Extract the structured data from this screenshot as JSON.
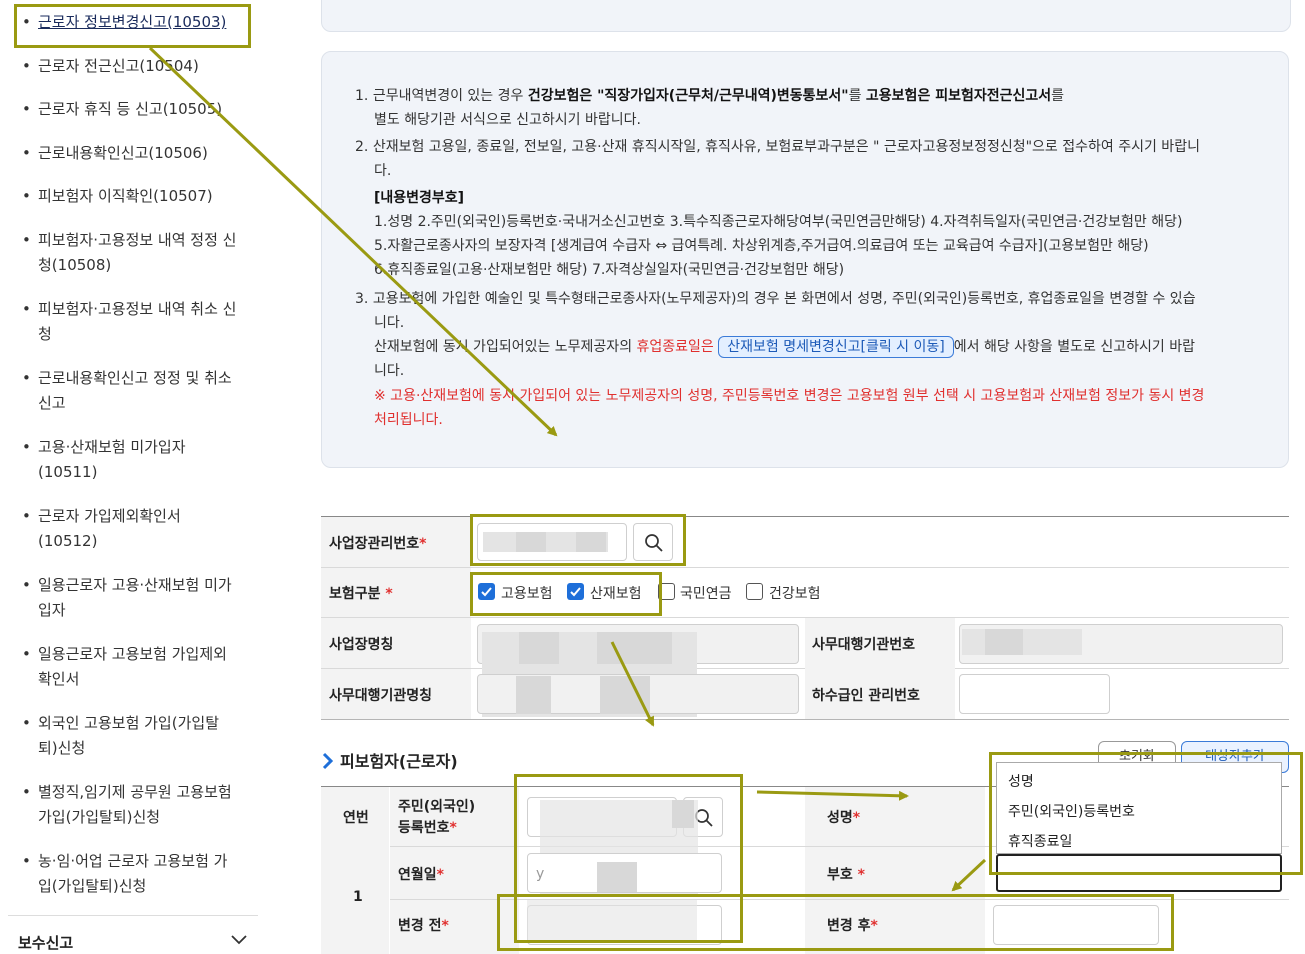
{
  "sidebar": {
    "items": [
      {
        "label": "근로자 정보변경신고(10503)"
      },
      {
        "label": "근로자 전근신고(10504)"
      },
      {
        "label": "근로자 휴직 등 신고(10505)"
      },
      {
        "label": "근로내용확인신고(10506)"
      },
      {
        "label": "피보험자 이직확인(10507)"
      },
      {
        "label": "피보험자·고용정보 내역 정정 신청(10508)"
      },
      {
        "label": "피보험자·고용정보 내역 취소 신청"
      },
      {
        "label": "근로내용확인신고 정정 및 취소 신고"
      },
      {
        "label": "고용·산재보험 미가입자 (10511)"
      },
      {
        "label": "근로자 가입제외확인서 (10512)"
      },
      {
        "label": "일용근로자 고용·산재보험 미가입자"
      },
      {
        "label": "일용근로자 고용보험 가입제외 확인서"
      },
      {
        "label": "외국인 고용보험 가입(가입탈퇴)신청"
      },
      {
        "label": "별정직,임기제 공무원 고용보험 가입(가입탈퇴)신청"
      },
      {
        "label": "농·임·어업 근로자 고용보험 가입(가입탈퇴)신청"
      }
    ],
    "section_label": "보수신고",
    "bullet": "•"
  },
  "notice": {
    "l1_num": "1.",
    "l1_a": "근무내역변경이 있는 경우 ",
    "l1_b": "건강보험은 \"직장가입자(근무처/근무내역)변동통보서\"",
    "l1_c": "를 ",
    "l1_d": "고용보험은 피보험자전근신고서",
    "l1_e": "를",
    "l1_2": "별도 해당기관 서식으로 신고하시기 바랍니다.",
    "l2_num": "2.",
    "l2_1": "산재보험 고용일, 종료일, 전보일, 고용·산재 휴직시작일, 휴직사유, 보험료부과구분은 \" 근로자고용정보정정신청\"으로 접수하여 주시기 바랍니",
    "l2_2": "다.",
    "code_title": "[내용변경부호]",
    "code_1": "1.성명 2.주민(외국인)등록번호·국내거소신고번호 3.특수직종근로자해당여부(국민연금만해당) 4.자격취득일자(국민연금·건강보험만 해당)",
    "code_2": "5.자활근로종사자의 보장자격 [생계급여 수급자 ⇔ 급여특례. 차상위계층,주거급여.의료급여 또는 교육급여 수급자](고용보험만 해당)",
    "code_3": "6.휴직종료일(고용·산재보험만 해당) 7.자격상실일자(국민연금·건강보험만 해당)",
    "l3_num": "3.",
    "l3_1": "고용보험에 가입한 예술인 및 특수형태근로종사자(노무제공자)의 경우 본 화면에서 성명, 주민(외국인)등록번호, 휴업종료일을 변경할 수 있습",
    "l3_2": "니다.",
    "l3_3a": "산재보험에 동시 가입되어있는 노무제공자의 ",
    "l3_3b": "휴업종료일은",
    "l3_link": "산재보험 명세변경신고[클릭 시 이동]",
    "l3_3c": "에서 해당 사항을 별도로 신고하시기 바랍",
    "l3_4": "니다.",
    "warn_1": "※ 고용·산재보험에 동시 가입되어 있는 노무제공자의 성명, 주민등록번호 변경은 고용보험 원부 선택 시 고용보험과 산재보험 정보가 동시 변경",
    "warn_2": "처리됩니다."
  },
  "form": {
    "biz_no_label": "사업장관리번호",
    "ins_type_label": "보험구분",
    "checkboxes": [
      {
        "label": "고용보험",
        "checked": true
      },
      {
        "label": "산재보험",
        "checked": true
      },
      {
        "label": "국민연금",
        "checked": false
      },
      {
        "label": "건강보험",
        "checked": false
      }
    ],
    "biz_name_label": "사업장명칭",
    "agency_no_label": "사무대행기관번호",
    "agency_name_label": "사무대행기관명칭",
    "subcontract_label": "하수급인 관리번호",
    "required_mark": "*"
  },
  "insured": {
    "section_title": "피보험자(근로자)",
    "btn_reset": "초기화",
    "btn_add": "대상자추가",
    "col_no": "연번",
    "col_id_1": "주민(외국인)",
    "col_id_2": "등록번호",
    "col_name": "성명",
    "col_birth": "연월일",
    "col_code": "부호",
    "col_before": "변경 전",
    "col_after": "변경 후",
    "row_no": "1",
    "birth_partial": "y"
  },
  "dropdown": {
    "options": [
      "성명",
      "주민(외국인)등록번호",
      "휴직종료일"
    ]
  },
  "colors": {
    "highlight": "#9a9a12",
    "required": "#e0302f",
    "checkbox_on": "#1e6fd9"
  },
  "icons": [
    "search-icon",
    "chevron-down-icon",
    "chevron-right-icon",
    "checkmark-icon"
  ]
}
